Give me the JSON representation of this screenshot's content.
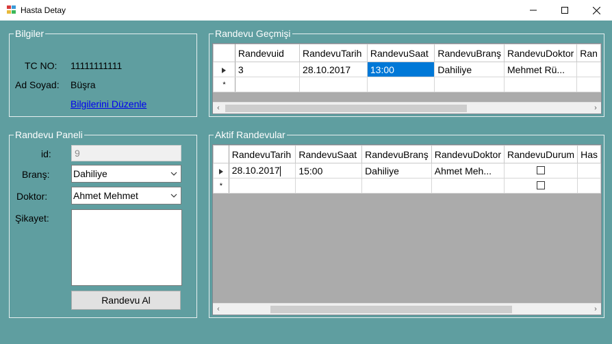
{
  "window": {
    "title": "Hasta Detay"
  },
  "bilgiler": {
    "legend": "Bilgiler",
    "tc_label": "TC NO:",
    "tc_value": "11111111111",
    "name_label": "Ad Soyad:",
    "name_value": "Büşra",
    "edit_link": "Bilgilerini Düzenle"
  },
  "panel": {
    "legend": "Randevu Paneli",
    "id_label": "id:",
    "id_value": "9",
    "brans_label": "Branş:",
    "brans_value": "Dahiliye",
    "doktor_label": "Doktor:",
    "doktor_value": "Ahmet Mehmet",
    "sikayet_label": "Şikayet:",
    "sikayet_value": "",
    "button": "Randevu Al"
  },
  "history": {
    "legend": "Randevu Geçmişi",
    "columns": [
      "Randevuid",
      "RandevuTarih",
      "RandevuSaat",
      "RandevuBranş",
      "RandevuDoktor",
      "Ran"
    ],
    "row": [
      "3",
      "28.10.2017",
      "13:00",
      "Dahiliye",
      "Mehmet Rü...",
      ""
    ],
    "new_row_marker": "*"
  },
  "active": {
    "legend": "Aktif Randevular",
    "columns": [
      "RandevuTarih",
      "RandevuSaat",
      "RandevuBranş",
      "RandevuDoktor",
      "RandevuDurum",
      "Has"
    ],
    "row": [
      "28.10.2017",
      "15:00",
      "Dahiliye",
      "Ahmet Meh...",
      "",
      ""
    ],
    "new_row_marker": "*"
  },
  "colors": {
    "background": "#5f9ea0",
    "selection": "#0078d7",
    "link": "#0000ee"
  }
}
